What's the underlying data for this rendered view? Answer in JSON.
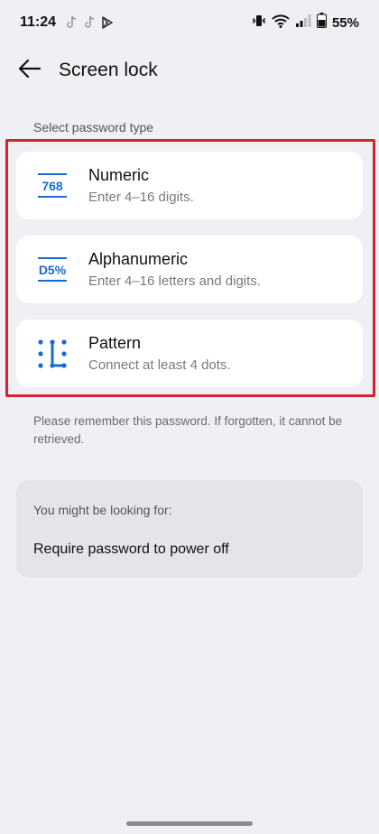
{
  "status_bar": {
    "time": "11:24",
    "notification_icons": [
      "tiktok-icon",
      "tiktok-icon",
      "play-store-icon"
    ],
    "system_icons": [
      "vibrate-icon",
      "wifi-icon",
      "signal-icon",
      "battery-icon"
    ],
    "battery": "55%"
  },
  "header": {
    "title": "Screen lock",
    "back_icon": "back-arrow-icon"
  },
  "section_label": "Select password type",
  "options": [
    {
      "icon": "numeric-icon",
      "icon_text": "768",
      "title": "Numeric",
      "subtitle": "Enter 4–16 digits."
    },
    {
      "icon": "alphanumeric-icon",
      "icon_text": "D5%",
      "title": "Alphanumeric",
      "subtitle": "Enter 4–16 letters and digits."
    },
    {
      "icon": "pattern-icon",
      "title": "Pattern",
      "subtitle": "Connect at least 4 dots."
    }
  ],
  "note": "Please remember this password. If forgotten, it cannot be retrieved.",
  "suggestion": {
    "label": "You might be looking for:",
    "link": "Require password to power off"
  },
  "colors": {
    "background": "#eff0f3",
    "card": "#ffffff",
    "accent_blue": "#1a6bd1",
    "highlight_red": "#d8202e"
  }
}
